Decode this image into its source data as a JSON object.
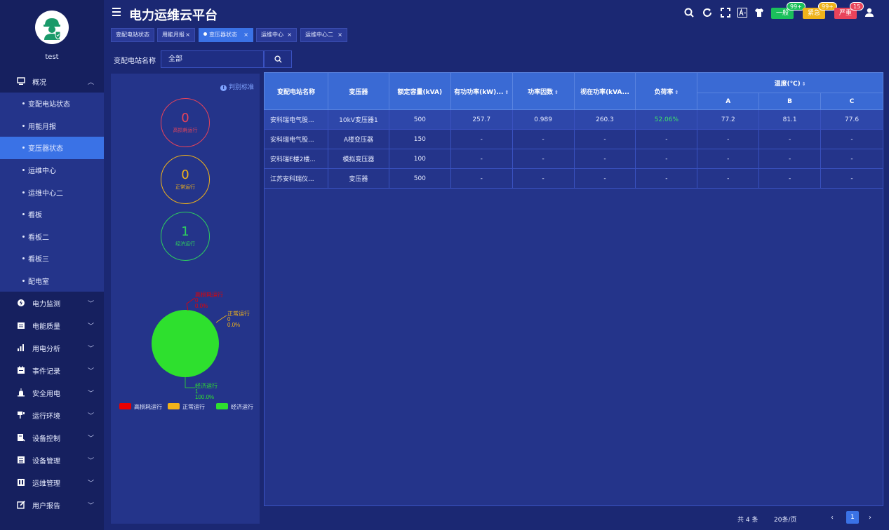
{
  "user": {
    "name": "test"
  },
  "header": {
    "title": "电力运维云平台",
    "alarms": [
      {
        "label": "一般",
        "count": "99+",
        "color": "#1bc05b"
      },
      {
        "label": "紧急",
        "count": "99+",
        "color": "#f0b21a"
      },
      {
        "label": "严重",
        "count": "15",
        "color": "#e8435a"
      }
    ]
  },
  "sidebar": {
    "groups": [
      {
        "label": "概况",
        "icon": "overview-icon",
        "expanded": true
      },
      {
        "label": "电力监测",
        "icon": "power-monitor-icon"
      },
      {
        "label": "电能质量",
        "icon": "power-quality-icon"
      },
      {
        "label": "用电分析",
        "icon": "analysis-icon"
      },
      {
        "label": "事件记录",
        "icon": "event-record-icon"
      },
      {
        "label": "安全用电",
        "icon": "safety-icon"
      },
      {
        "label": "运行环境",
        "icon": "environment-icon"
      },
      {
        "label": "设备控制",
        "icon": "device-control-icon"
      },
      {
        "label": "设备管理",
        "icon": "device-manage-icon"
      },
      {
        "label": "运维管理",
        "icon": "ops-manage-icon"
      },
      {
        "label": "用户报告",
        "icon": "report-icon"
      }
    ],
    "sub_items": [
      "变配电站状态",
      "用能月报",
      "变压器状态",
      "运维中心",
      "运维中心二",
      "看板",
      "看板二",
      "看板三",
      "配电室"
    ],
    "active_sub": "变压器状态"
  },
  "tabs": [
    {
      "label": "变配电站状态"
    },
    {
      "label": "用能月报"
    },
    {
      "label": "变压器状态",
      "active": true
    },
    {
      "label": "运维中心"
    },
    {
      "label": "运维中心二"
    }
  ],
  "filter": {
    "label": "变配电站名称",
    "value": "全部"
  },
  "status_panel": {
    "criteria_label": "判别标准",
    "rings": [
      {
        "value": "0",
        "label": "高损耗运行",
        "color": "#e8435a"
      },
      {
        "value": "0",
        "label": "正常运行",
        "color": "#f0b21a"
      },
      {
        "value": "1",
        "label": "经济运行",
        "color": "#2ecf5e"
      }
    ]
  },
  "chart_data": {
    "type": "pie",
    "categories": [
      "高损耗运行",
      "正常运行",
      "经济运行"
    ],
    "values": [
      0,
      0,
      1
    ],
    "percent_labels": [
      "0.0%",
      "0.0%",
      "100.0%"
    ],
    "colors": [
      "#e80000",
      "#f0b21a",
      "#2ee02e"
    ],
    "legend": "bottom"
  },
  "table": {
    "headers": {
      "station": "变配电站名称",
      "transformer": "变压器",
      "capacity": "额定容量(kVA)",
      "active_power": "有功功率(kW)...",
      "power_factor": "功率因数",
      "apparent_power": "视在功率(kVA...",
      "load_rate": "负荷率",
      "temperature": "温度(℃)",
      "temp_a": "A",
      "temp_b": "B",
      "temp_c": "C"
    },
    "rows": [
      [
        "安科瑞电气股...",
        "10kV变压器1",
        "500",
        "257.7",
        "0.989",
        "260.3",
        "52.06%",
        "77.2",
        "81.1",
        "77.6"
      ],
      [
        "安科瑞电气股...",
        "A楼变压器",
        "150",
        "-",
        "-",
        "-",
        "-",
        "-",
        "-",
        "-"
      ],
      [
        "安科瑞E楼2楼...",
        "模拟变压器",
        "100",
        "-",
        "-",
        "-",
        "-",
        "-",
        "-",
        "-"
      ],
      [
        "江苏安科瑞仪...",
        "变压器",
        "500",
        "-",
        "-",
        "-",
        "-",
        "-",
        "-",
        "-"
      ]
    ]
  },
  "pagination": {
    "total": "共 4 条",
    "page_size": "20条/页",
    "current_page": "1"
  }
}
